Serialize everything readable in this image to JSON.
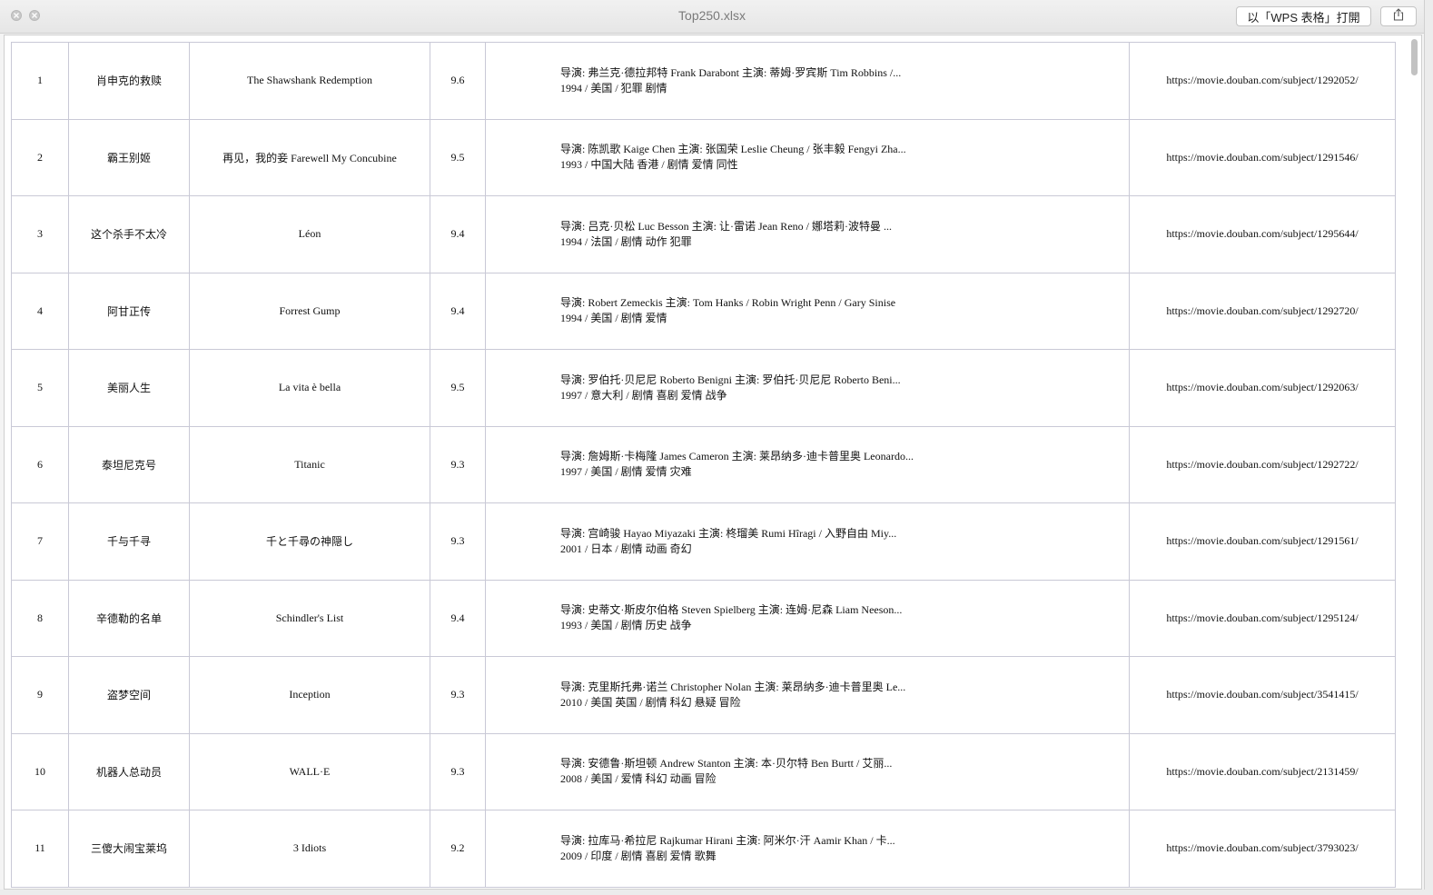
{
  "window": {
    "title": "Top250.xlsx",
    "open_button": "以「WPS 表格」打開"
  },
  "icons": {
    "close": "close-icon",
    "minimize": "minimize-icon",
    "share": "share-icon"
  },
  "rows": [
    {
      "rank": "1",
      "cn_title": "肖申克的救赎",
      "orig_title": "The Shawshank Redemption",
      "rating": "9.6",
      "info1": "导演: 弗兰克·德拉邦特 Frank Darabont   主演: 蒂姆·罗宾斯 Tim Robbins /...",
      "info2": "1994 / 美国 / 犯罪 剧情",
      "url": "https://movie.douban.com/subject/1292052/"
    },
    {
      "rank": "2",
      "cn_title": "霸王别姬",
      "orig_title": "再见，我的妾    Farewell My Concubine",
      "rating": "9.5",
      "info1": "导演: 陈凯歌 Kaige Chen   主演: 张国荣 Leslie Cheung / 张丰毅 Fengyi Zha...",
      "info2": "1993 / 中国大陆 香港 / 剧情 爱情 同性",
      "url": "https://movie.douban.com/subject/1291546/"
    },
    {
      "rank": "3",
      "cn_title": "这个杀手不太冷",
      "orig_title": "Léon",
      "rating": "9.4",
      "info1": "导演: 吕克·贝松 Luc Besson   主演: 让·雷诺 Jean Reno / 娜塔莉·波特曼 ...",
      "info2": "1994 / 法国 / 剧情 动作 犯罪",
      "url": "https://movie.douban.com/subject/1295644/"
    },
    {
      "rank": "4",
      "cn_title": "阿甘正传",
      "orig_title": "Forrest Gump",
      "rating": "9.4",
      "info1": "导演: Robert Zemeckis   主演: Tom Hanks / Robin Wright Penn / Gary Sinise",
      "info2": "1994 / 美国 / 剧情 爱情",
      "url": "https://movie.douban.com/subject/1292720/"
    },
    {
      "rank": "5",
      "cn_title": "美丽人生",
      "orig_title": "La vita è bella",
      "rating": "9.5",
      "info1": "导演: 罗伯托·贝尼尼 Roberto Benigni   主演: 罗伯托·贝尼尼 Roberto Beni...",
      "info2": "1997 / 意大利 / 剧情 喜剧 爱情 战争",
      "url": "https://movie.douban.com/subject/1292063/"
    },
    {
      "rank": "6",
      "cn_title": "泰坦尼克号",
      "orig_title": "Titanic",
      "rating": "9.3",
      "info1": "导演: 詹姆斯·卡梅隆 James Cameron   主演: 莱昂纳多·迪卡普里奥 Leonardo...",
      "info2": "1997 / 美国 / 剧情 爱情 灾难",
      "url": "https://movie.douban.com/subject/1292722/"
    },
    {
      "rank": "7",
      "cn_title": "千与千寻",
      "orig_title": "千と千尋の神隠し",
      "rating": "9.3",
      "info1": "导演: 宫崎骏 Hayao Miyazaki   主演: 柊瑠美 Rumi Hîragi / 入野自由 Miy...",
      "info2": "2001 / 日本 / 剧情 动画 奇幻",
      "url": "https://movie.douban.com/subject/1291561/"
    },
    {
      "rank": "8",
      "cn_title": "辛德勒的名单",
      "orig_title": "Schindler's List",
      "rating": "9.4",
      "info1": "导演: 史蒂文·斯皮尔伯格 Steven Spielberg   主演: 连姆·尼森 Liam Neeson...",
      "info2": "1993 / 美国 / 剧情 历史 战争",
      "url": "https://movie.douban.com/subject/1295124/"
    },
    {
      "rank": "9",
      "cn_title": "盗梦空间",
      "orig_title": "Inception",
      "rating": "9.3",
      "info1": "导演: 克里斯托弗·诺兰 Christopher Nolan   主演: 莱昂纳多·迪卡普里奥 Le...",
      "info2": "2010 / 美国 英国 / 剧情 科幻 悬疑 冒险",
      "url": "https://movie.douban.com/subject/3541415/"
    },
    {
      "rank": "10",
      "cn_title": "机器人总动员",
      "orig_title": "WALL·E",
      "rating": "9.3",
      "info1": "导演: 安德鲁·斯坦顿 Andrew Stanton   主演: 本·贝尔特 Ben Burtt / 艾丽...",
      "info2": "2008 / 美国 / 爱情 科幻 动画 冒险",
      "url": "https://movie.douban.com/subject/2131459/"
    },
    {
      "rank": "11",
      "cn_title": "三傻大闹宝莱坞",
      "orig_title": "3 Idiots",
      "rating": "9.2",
      "info1": "导演: 拉库马·希拉尼 Rajkumar Hirani   主演: 阿米尔·汗 Aamir Khan / 卡...",
      "info2": "2009 / 印度 / 剧情 喜剧 爱情 歌舞",
      "url": "https://movie.douban.com/subject/3793023/"
    }
  ]
}
